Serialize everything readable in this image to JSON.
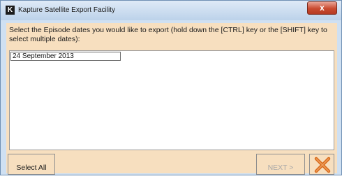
{
  "window": {
    "title": "Kapture Satellite Export Facility",
    "app_icon_glyph": "K",
    "close_glyph": "x"
  },
  "instructions": "Select the Episode dates you would like to export (hold down the [CTRL] key or the [SHIFT] key to select multiple dates):",
  "date_list": {
    "items": [
      "24 September 2013"
    ]
  },
  "buttons": {
    "select_all_label": "Select All",
    "next_label": "NEXT >",
    "cancel_icon": "cancel-x-icon"
  },
  "colors": {
    "client_background": "#f7dfbf",
    "cancel_x": "#d86b1c"
  }
}
